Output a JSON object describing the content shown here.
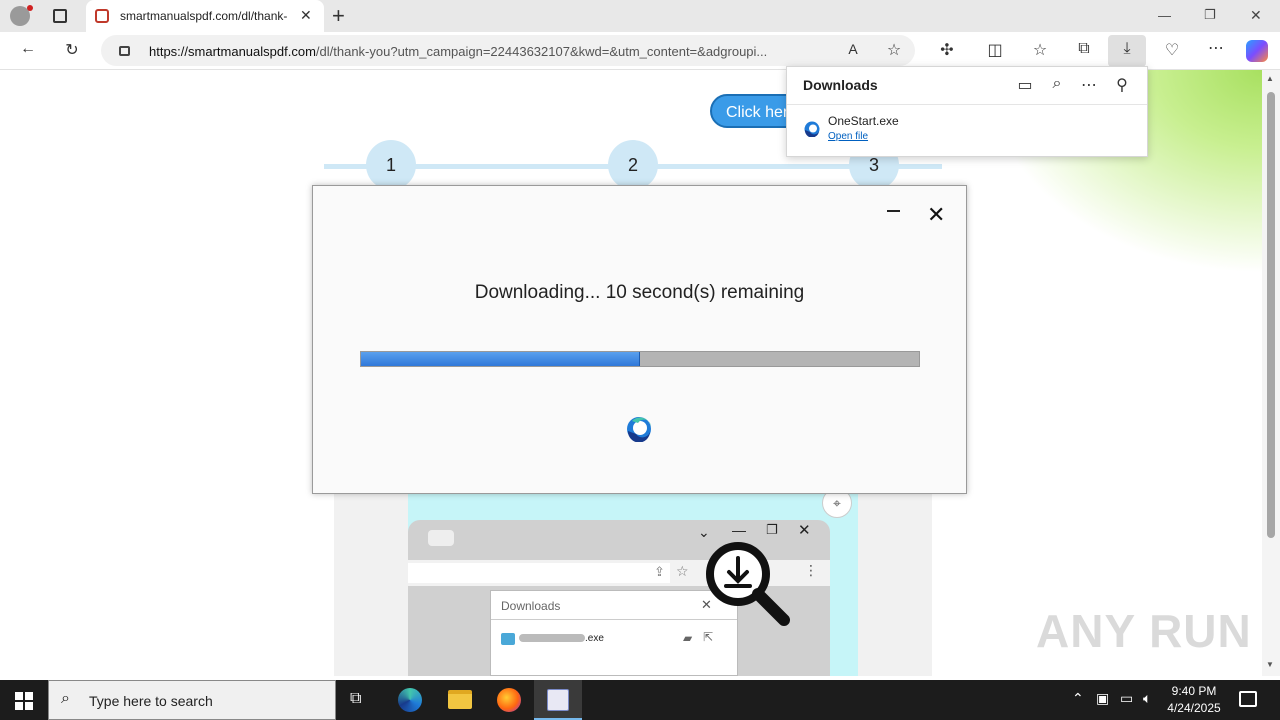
{
  "browser": {
    "tab_title": "smartmanualspdf.com/dl/thank-",
    "address_scheme_host": "https://smartmanualspdf.com",
    "address_rest": "/dl/thank-you?utm_campaign=22443632107&kwd=&utm_content=&adgroupi...",
    "new_tab": "+",
    "close_tab": "✕",
    "window_controls": [
      "—",
      "❐",
      "✕"
    ]
  },
  "page": {
    "click_here": "Click here",
    "steps": [
      "1",
      "2",
      "3"
    ]
  },
  "modal": {
    "message": "Downloading... 10 second(s) remaining",
    "progress": 0.5,
    "close": "✕"
  },
  "downloads_panel": {
    "title": "Downloads",
    "file_name": "OneStart.exe",
    "open_file": "Open file"
  },
  "illustration": {
    "panel_title": "Downloads",
    "file_ext": ".exe"
  },
  "taskbar": {
    "search_placeholder": "Type here to search",
    "time": "9:40 PM",
    "date": "4/24/2025"
  },
  "watermark": "ANY RUN",
  "colors": {
    "accent": "#3a9be8",
    "progress": "#2f78d9",
    "step": "#cfe8f6"
  }
}
